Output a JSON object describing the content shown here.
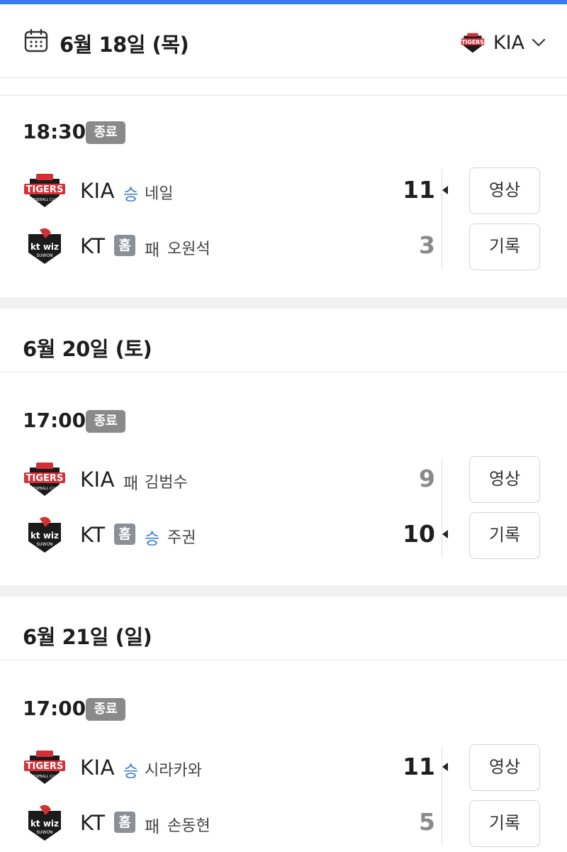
{
  "header": {
    "date": "6월 18일 (목)",
    "team_selected": "KIA"
  },
  "days": [
    {
      "date_label": "",
      "time": "18:30",
      "status": "종료",
      "away": {
        "team": "KIA",
        "result": "승",
        "pitcher": "네일",
        "score": "11",
        "winner": true
      },
      "home": {
        "team": "KT",
        "badge": "홈",
        "result": "패",
        "pitcher": "오원석",
        "score": "3",
        "winner": false
      },
      "buttons": {
        "video": "영상",
        "record": "기록"
      }
    },
    {
      "date_label": "6월 20일 (토)",
      "time": "17:00",
      "status": "종료",
      "away": {
        "team": "KIA",
        "result": "패",
        "pitcher": "김범수",
        "score": "9",
        "winner": false
      },
      "home": {
        "team": "KT",
        "badge": "홈",
        "result": "승",
        "pitcher": "주권",
        "score": "10",
        "winner": true
      },
      "buttons": {
        "video": "영상",
        "record": "기록"
      }
    },
    {
      "date_label": "6월 21일 (일)",
      "time": "17:00",
      "status": "종료",
      "away": {
        "team": "KIA",
        "result": "승",
        "pitcher": "시라카와",
        "score": "11",
        "winner": true
      },
      "home": {
        "team": "KT",
        "badge": "홈",
        "result": "패",
        "pitcher": "손동현",
        "score": "5",
        "winner": false
      },
      "buttons": {
        "video": "영상",
        "record": "기록"
      }
    }
  ],
  "colors": {
    "accent": "#3a7bf0",
    "win": "#3a78d6",
    "badge_gray": "#8a8a8a"
  },
  "icons": {
    "calendar": "calendar-icon",
    "chevron": "chevron-down-icon",
    "tigers_logo": "tigers-logo",
    "ktwiz_logo": "ktwiz-logo"
  }
}
